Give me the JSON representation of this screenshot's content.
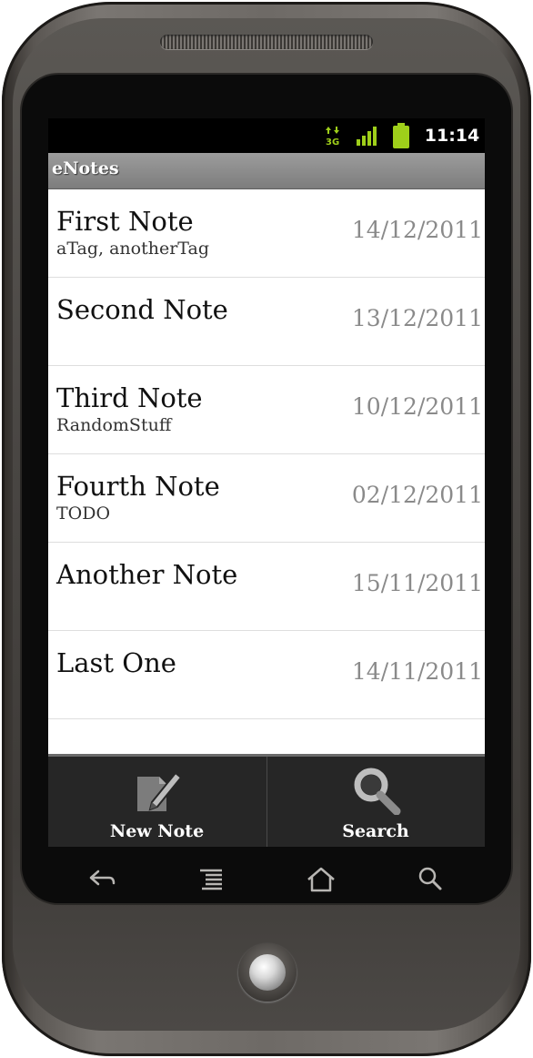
{
  "status_bar": {
    "network_label": "3G",
    "time": "11:14",
    "icons": [
      "network-3g-icon",
      "signal-icon",
      "battery-icon"
    ],
    "accent_color": "#9fcf1a"
  },
  "app": {
    "title": "eNotes"
  },
  "notes": [
    {
      "title": "First Note",
      "tags": "aTag, anotherTag",
      "date": "14/12/2011"
    },
    {
      "title": "Second Note",
      "tags": "",
      "date": "13/12/2011"
    },
    {
      "title": "Third Note",
      "tags": "RandomStuff",
      "date": "10/12/2011"
    },
    {
      "title": "Fourth Note",
      "tags": "TODO",
      "date": "02/12/2011"
    },
    {
      "title": "Another Note",
      "tags": "",
      "date": "15/11/2011"
    },
    {
      "title": "Last One",
      "tags": "",
      "date": "14/11/2011"
    }
  ],
  "menu": {
    "new_note": {
      "label": "New Note",
      "icon": "edit-note-icon"
    },
    "search": {
      "label": "Search",
      "icon": "magnifier-icon"
    }
  },
  "hardware_buttons": [
    "back-icon",
    "menu-icon",
    "home-icon",
    "search-icon"
  ]
}
